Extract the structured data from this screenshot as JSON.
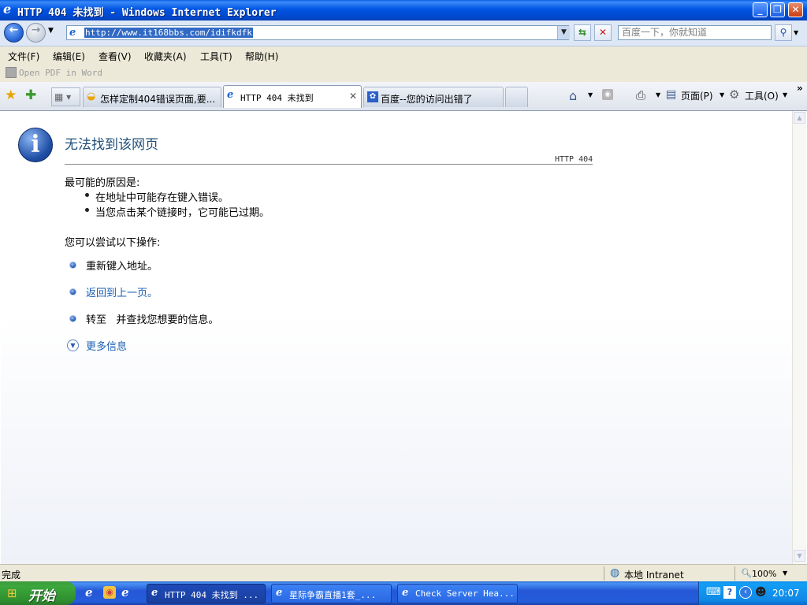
{
  "window": {
    "title": "HTTP 404 未找到 - Windows Internet Explorer"
  },
  "address": {
    "url": "http://www.it168bbs.com/idifkdfk"
  },
  "search": {
    "placeholder": "百度一下，你就知道"
  },
  "menu": [
    "文件(F)",
    "编辑(E)",
    "查看(V)",
    "收藏夹(A)",
    "工具(T)",
    "帮助(H)"
  ],
  "pdf_toolbar": {
    "label": "Open PDF in Word"
  },
  "tabs": [
    {
      "label": "怎样定制404错误页面,要..."
    },
    {
      "label": "HTTP 404 未找到"
    },
    {
      "label": "百度--您的访问出错了"
    }
  ],
  "command_bar": {
    "page": "页面(P)",
    "tools": "工具(O)"
  },
  "page": {
    "heading": "无法找到该网页",
    "http_code": "HTTP 404",
    "causes_title": "最可能的原因是:",
    "causes": [
      "在地址中可能存在键入错误。",
      "当您点击某个链接时，它可能已过期。"
    ],
    "actions_title": "您可以尝试以下操作:",
    "actions": [
      "重新键入地址。",
      "返回到上一页。",
      "转至   并查找您想要的信息。"
    ],
    "more_info": "更多信息"
  },
  "status": {
    "text": "完成",
    "zone": "本地 Intranet",
    "zoom": "100%"
  },
  "taskbar": {
    "start": "开始",
    "tasks": [
      "HTTP 404 未找到 ...",
      "星际争霸直播1套_...",
      "Check Server Hea..."
    ],
    "clock": "20:07"
  },
  "colors": {
    "titlebar": "#0054e3",
    "link": "#1a5fb4",
    "heading": "#1f4e79"
  }
}
